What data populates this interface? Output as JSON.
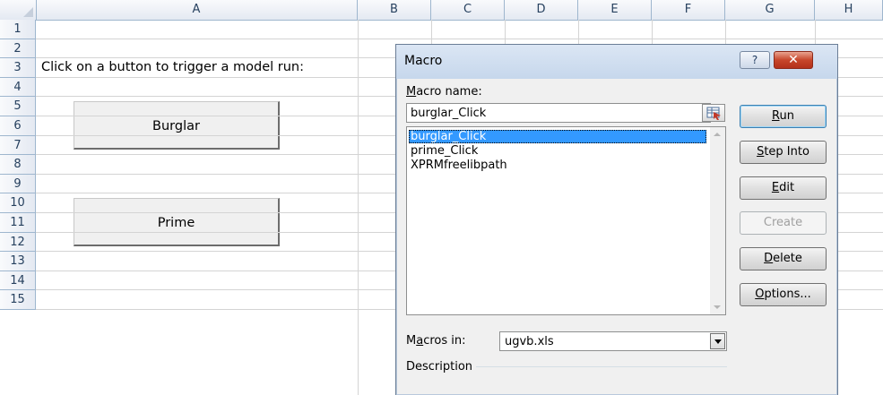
{
  "spreadsheet": {
    "columns": [
      "A",
      "B",
      "C",
      "D",
      "E",
      "F",
      "G",
      "H"
    ],
    "rows": [
      "1",
      "2",
      "3",
      "4",
      "5",
      "6",
      "7",
      "8",
      "9",
      "10",
      "11",
      "12",
      "13",
      "14",
      "15"
    ],
    "cell_a2": "Click on a button to trigger a model run:",
    "buttons": {
      "burglar": "Burglar",
      "prime": "Prime"
    }
  },
  "dialog": {
    "title": "Macro",
    "help_label": "?",
    "close_label": "✕",
    "macro_name_label": "acro name:",
    "macro_name_mnemonic": "M",
    "macro_name_value": "burglar_Click",
    "macros": [
      "burglar_Click",
      "prime_Click",
      "XPRMfreelibpath"
    ],
    "selected_index": 0,
    "buttons": {
      "run": {
        "mnemonic": "R",
        "rest": "un"
      },
      "step_into": {
        "mnemonic": "S",
        "rest": "tep Into"
      },
      "edit": {
        "mnemonic": "E",
        "rest": "dit"
      },
      "create": "Create",
      "delete": {
        "mnemonic": "D",
        "rest": "elete"
      },
      "options": {
        "mnemonic": "O",
        "rest": "ptions..."
      }
    },
    "macros_in_label_a": "M",
    "macros_in_label_m": "a",
    "macros_in_label_b": "cros in:",
    "macros_in_value": "ugvb.xls",
    "description_label": "Description"
  }
}
